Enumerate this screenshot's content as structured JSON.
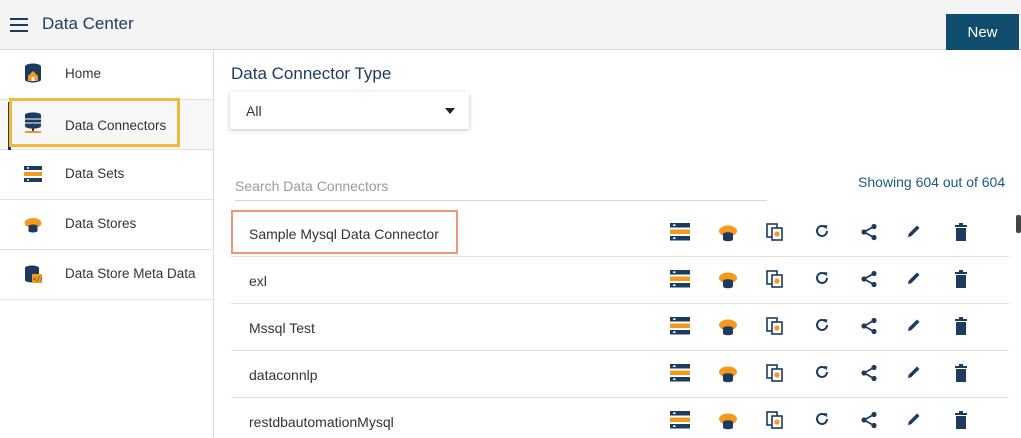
{
  "header": {
    "title": "Data Center",
    "new_button": "New"
  },
  "sidebar": {
    "items": [
      {
        "label": "Home",
        "icon": "home-icon"
      },
      {
        "label": "Data Connectors",
        "icon": "database-connector-icon",
        "active": true
      },
      {
        "label": "Data Sets",
        "icon": "dataset-icon"
      },
      {
        "label": "Data Stores",
        "icon": "datastore-icon"
      },
      {
        "label": "Data Store Meta Data",
        "icon": "datastore-meta-icon"
      }
    ]
  },
  "main": {
    "section_title": "Data Connector Type",
    "type_filter": {
      "selected": "All"
    },
    "search": {
      "placeholder": "Search Data Connectors",
      "value": ""
    },
    "showing_text": "Showing 604 out of 604",
    "connectors": [
      {
        "name": "Sample Mysql Data Connector"
      },
      {
        "name": "exl"
      },
      {
        "name": "Mssql Test"
      },
      {
        "name": "dataconnlp"
      },
      {
        "name": "restdbautomationMysql"
      }
    ],
    "row_actions": [
      "dataset-icon",
      "datastore-icon",
      "clone-icon",
      "refresh-icon",
      "share-icon",
      "edit-icon",
      "delete-icon"
    ]
  },
  "colors": {
    "brand": "#1d3a5f",
    "button": "#0f4c6e",
    "accent_orange": "#f39a1e",
    "highlight_yellow": "#f2b73c",
    "highlight_salmon": "#f0957a"
  }
}
